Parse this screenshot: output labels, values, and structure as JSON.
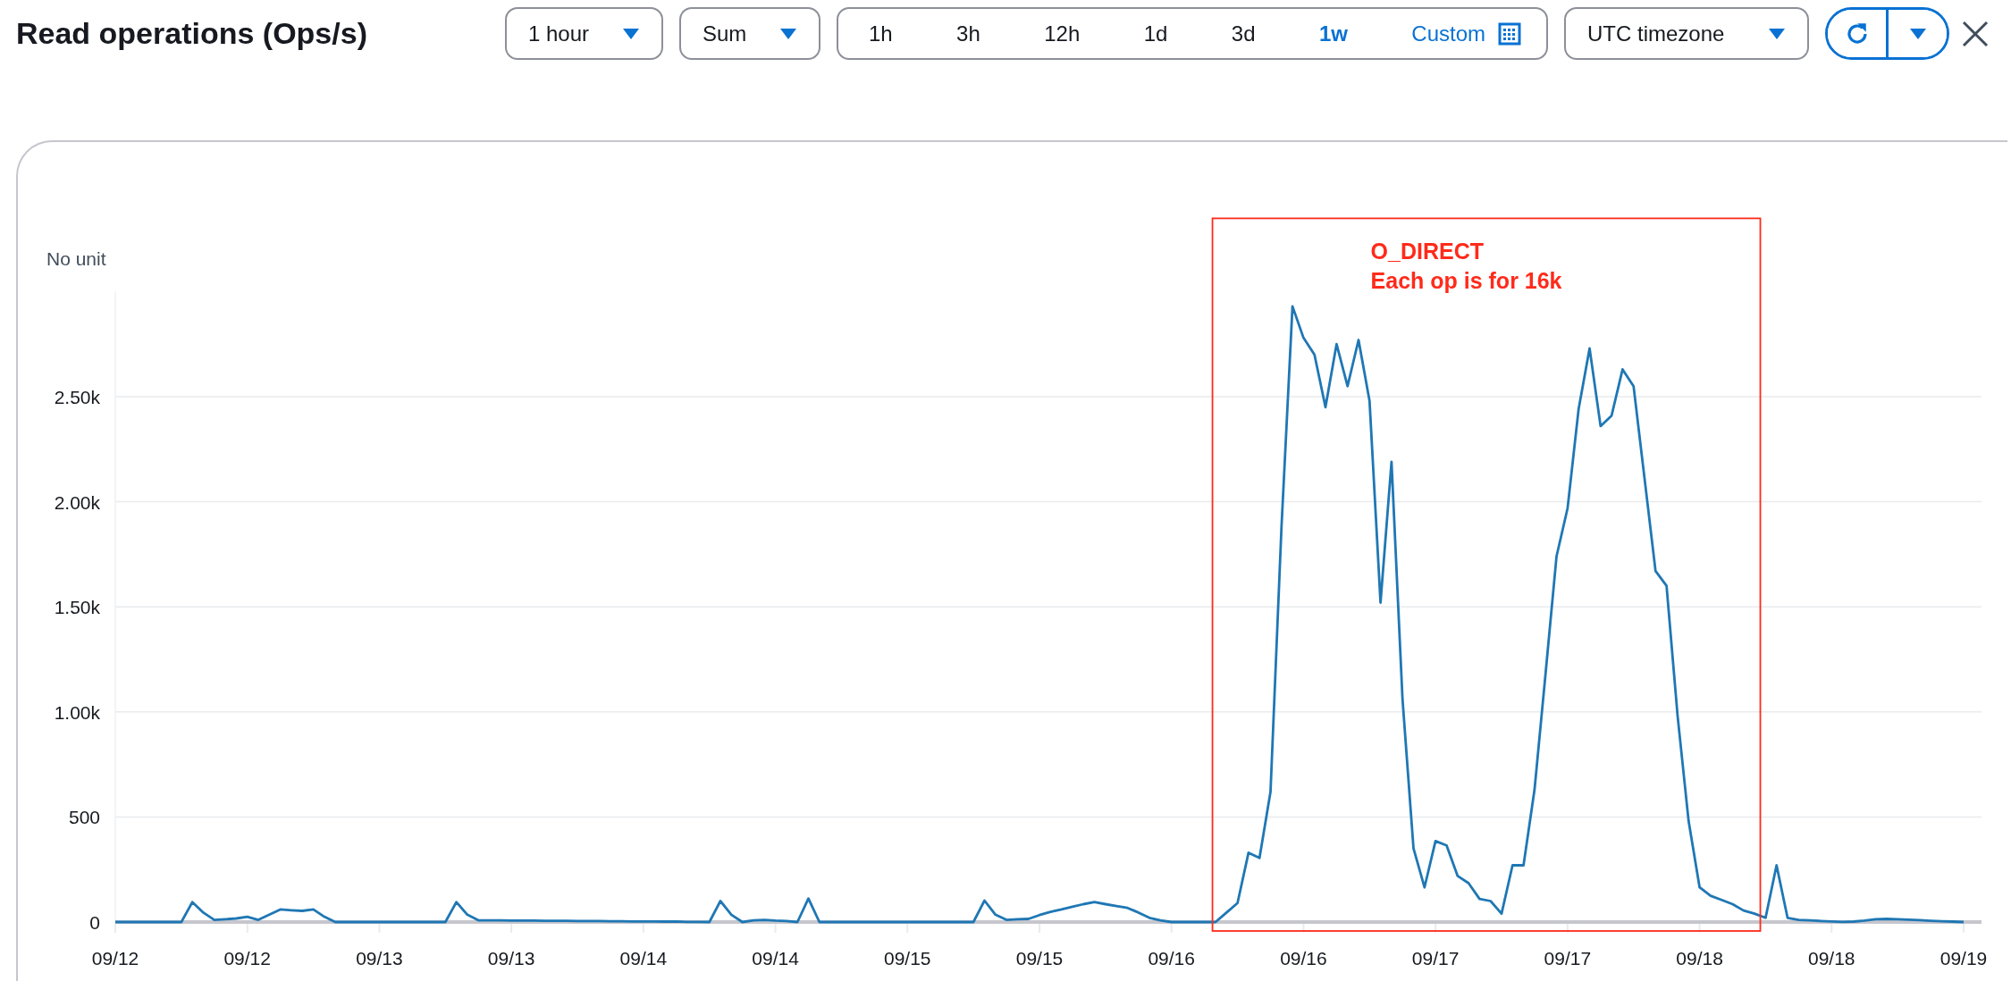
{
  "title": "Read operations (Ops/s)",
  "period": {
    "value": "1 hour"
  },
  "statistic": {
    "value": "Sum"
  },
  "time_range": {
    "options": [
      {
        "label": "1h",
        "kind": "preset",
        "selected": false
      },
      {
        "label": "3h",
        "kind": "preset",
        "selected": false
      },
      {
        "label": "12h",
        "kind": "preset",
        "selected": false
      },
      {
        "label": "1d",
        "kind": "preset",
        "selected": false
      },
      {
        "label": "3d",
        "kind": "preset",
        "selected": false
      },
      {
        "label": "1w",
        "kind": "preset",
        "selected": true
      },
      {
        "label": "Custom",
        "kind": "custom",
        "selected": false
      }
    ]
  },
  "timezone": {
    "value": "UTC timezone"
  },
  "chart": {
    "unit_label": "No unit",
    "chart_data": {
      "type": "line",
      "grid": true,
      "ylim": [
        0,
        3000
      ],
      "yticks": [
        {
          "value": 0,
          "label": "0"
        },
        {
          "value": 500,
          "label": "500"
        },
        {
          "value": 1000,
          "label": "1.00k"
        },
        {
          "value": 1500,
          "label": "1.50k"
        },
        {
          "value": 2000,
          "label": "2.00k"
        },
        {
          "value": 2500,
          "label": "2.50k"
        }
      ],
      "categories": [
        "09/12",
        null,
        null,
        null,
        null,
        null,
        null,
        null,
        null,
        null,
        null,
        null,
        "09/12",
        null,
        null,
        null,
        null,
        null,
        null,
        null,
        null,
        null,
        null,
        null,
        "09/13",
        null,
        null,
        null,
        null,
        null,
        null,
        null,
        null,
        null,
        null,
        null,
        "09/13",
        null,
        null,
        null,
        null,
        null,
        null,
        null,
        null,
        null,
        null,
        null,
        "09/14",
        null,
        null,
        null,
        null,
        null,
        null,
        null,
        null,
        null,
        null,
        null,
        "09/14",
        null,
        null,
        null,
        null,
        null,
        null,
        null,
        null,
        null,
        null,
        null,
        "09/15",
        null,
        null,
        null,
        null,
        null,
        null,
        null,
        null,
        null,
        null,
        null,
        "09/15",
        null,
        null,
        null,
        null,
        null,
        null,
        null,
        null,
        null,
        null,
        null,
        "09/16",
        null,
        null,
        null,
        null,
        null,
        null,
        null,
        null,
        null,
        null,
        null,
        "09/16",
        null,
        null,
        null,
        null,
        null,
        null,
        null,
        null,
        null,
        null,
        null,
        "09/17",
        null,
        null,
        null,
        null,
        null,
        null,
        null,
        null,
        null,
        null,
        null,
        "09/17",
        null,
        null,
        null,
        null,
        null,
        null,
        null,
        null,
        null,
        null,
        null,
        "09/18",
        null,
        null,
        null,
        null,
        null,
        null,
        null,
        null,
        null,
        null,
        null,
        "09/18",
        null,
        null,
        null,
        null,
        null,
        null,
        null,
        null,
        null,
        null,
        null,
        "09/19"
      ],
      "series": [
        {
          "color": "#1f77b4",
          "values": [
            0,
            0,
            0,
            0,
            0,
            0,
            0,
            95,
            45,
            10,
            13,
            17,
            25,
            10,
            35,
            60,
            56,
            53,
            60,
            25,
            0,
            0,
            0,
            0,
            0,
            0,
            0,
            0,
            0,
            0,
            0,
            95,
            35,
            8,
            8,
            8,
            7,
            7,
            7,
            6,
            6,
            6,
            5,
            5,
            5,
            4,
            4,
            3,
            3,
            3,
            2,
            2,
            1,
            1,
            0,
            100,
            35,
            0,
            8,
            10,
            7,
            5,
            0,
            112,
            0,
            0,
            0,
            0,
            0,
            0,
            0,
            0,
            0,
            0,
            0,
            0,
            0,
            0,
            0,
            102,
            35,
            10,
            13,
            15,
            33,
            48,
            60,
            73,
            85,
            95,
            85,
            76,
            67,
            45,
            20,
            8,
            0,
            0,
            0,
            0,
            0,
            45,
            90,
            330,
            305,
            620,
            1880,
            2930,
            2780,
            2700,
            2450,
            2750,
            2550,
            2770,
            2480,
            1520,
            2190,
            1060,
            350,
            165,
            385,
            365,
            220,
            185,
            110,
            100,
            40,
            270,
            270,
            630,
            1180,
            1740,
            1970,
            2440,
            2730,
            2360,
            2410,
            2630,
            2550,
            2110,
            1670,
            1600,
            980,
            480,
            165,
            125,
            105,
            85,
            55,
            40,
            20,
            270,
            20,
            10,
            8,
            5,
            3,
            1,
            2,
            7,
            13,
            15,
            13,
            11,
            9,
            6,
            4,
            2,
            0
          ]
        }
      ],
      "annotations": [
        "O_DIRECT",
        "Each op is for 16k"
      ]
    }
  }
}
